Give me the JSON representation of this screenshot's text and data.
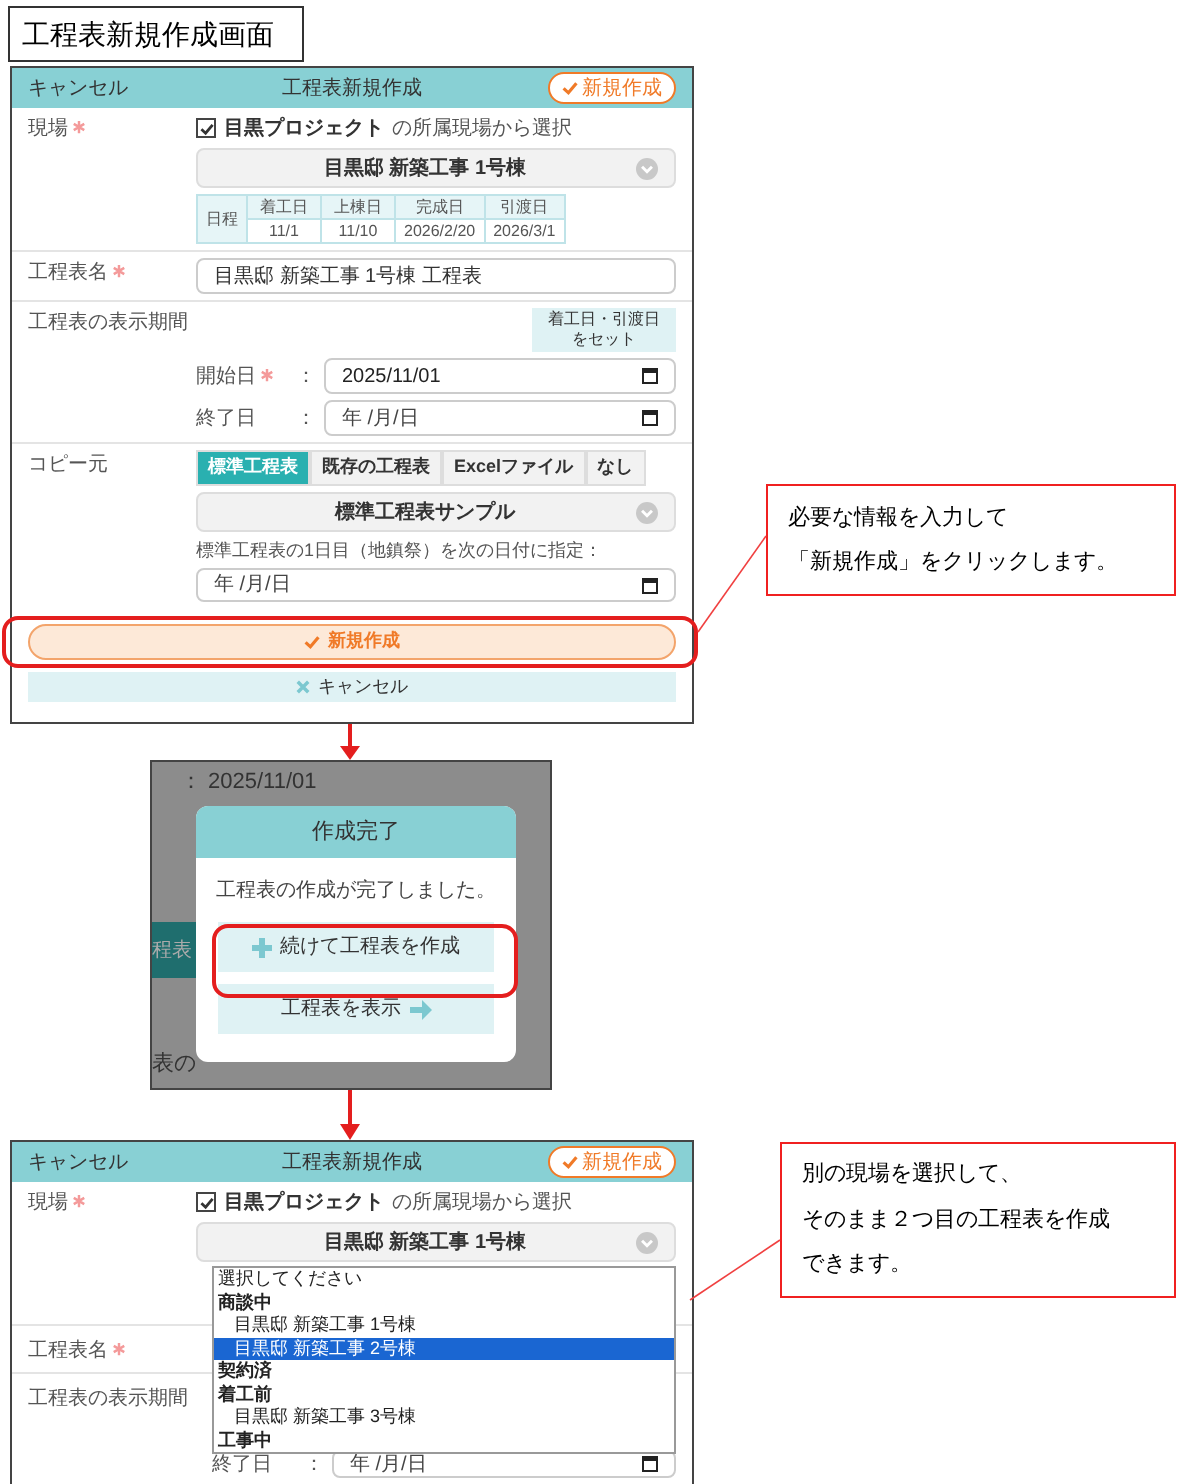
{
  "title": "工程表新規作成画面",
  "form_screen": {
    "header": {
      "cancel": "キャンセル",
      "title": "工程表新規作成",
      "create": "新規作成"
    },
    "site": {
      "label": "現場",
      "required": true,
      "checkbox": {
        "checked": true,
        "project": "目黒プロジェクト",
        "suffix": "の所属現場から選択"
      },
      "select": "目黒邸 新築工事 1号棟",
      "schedule": {
        "row_label": "日程",
        "columns": [
          "着工日",
          "上棟日",
          "完成日",
          "引渡日"
        ],
        "values": [
          "11/1",
          "11/10",
          "2026/2/20",
          "2026/3/1"
        ]
      }
    },
    "name": {
      "label": "工程表名",
      "required": true,
      "value": "目黒邸 新築工事 1号棟 工程表"
    },
    "period": {
      "label": "工程表の表示期間",
      "set_button": [
        "着工日・引渡日",
        "をセット"
      ],
      "fields": [
        {
          "label": "開始日",
          "required": true,
          "separator": "：",
          "value": "2025/11/01"
        },
        {
          "label": "終了日",
          "required": false,
          "separator": "：",
          "placeholder": "年 /月/日"
        }
      ]
    },
    "copy": {
      "label": "コピー元",
      "options": [
        {
          "label": "標準工程表",
          "selected": true
        },
        {
          "label": "既存の工程表",
          "selected": false
        },
        {
          "label": "Excelファイル",
          "selected": false
        },
        {
          "label": "なし",
          "selected": false
        }
      ],
      "select": "標準工程表サンプル",
      "note": "標準工程表の1日目（地鎮祭）を次の日付に指定：",
      "date_placeholder": "年 /月/日"
    },
    "create_button": "新規作成",
    "cancel_button": "キャンセル"
  },
  "callouts": [
    {
      "lines": [
        "必要な情報を入力して",
        "「新規作成」をクリックします。"
      ]
    },
    {
      "lines": [
        "別の現場を選択して、",
        "そのまま２つ目の工程表を作成",
        "できます。"
      ]
    }
  ],
  "dialog_screen": {
    "background": {
      "separator": "：",
      "date": "2025/11/01",
      "tab_fragment": "程表",
      "text_fragment": "表の"
    },
    "dialog": {
      "title": "作成完了",
      "message": "工程表の作成が完了しました。",
      "buttons": [
        {
          "label": "続けて工程表を作成",
          "kind": "add"
        },
        {
          "label": "工程表を表示",
          "kind": "view"
        }
      ]
    }
  },
  "dropdown_screen": {
    "header": {
      "cancel": "キャンセル",
      "title": "工程表新規作成",
      "create": "新規作成"
    },
    "site": {
      "label": "現場",
      "required": true,
      "checkbox": {
        "checked": true,
        "project": "目黒プロジェクト",
        "suffix": "の所属現場から選択"
      },
      "select": "目黒邸 新築工事 1号棟"
    },
    "options": [
      {
        "label": "選択してください",
        "kind": "prompt",
        "selected": false
      },
      {
        "label": "商談中",
        "kind": "group",
        "selected": false
      },
      {
        "label": "目黒邸 新築工事 1号棟",
        "kind": "option",
        "selected": false
      },
      {
        "label": "目黒邸 新築工事 2号棟",
        "kind": "option",
        "selected": true
      },
      {
        "label": "契約済",
        "kind": "group",
        "selected": false
      },
      {
        "label": "着工前",
        "kind": "group",
        "selected": false
      },
      {
        "label": "目黒邸 新築工事 3号棟",
        "kind": "option",
        "selected": false
      },
      {
        "label": "工事中",
        "kind": "group",
        "selected": false
      }
    ],
    "name_label": {
      "label": "工程表名",
      "required": true
    },
    "period_label": "工程表の表示期間",
    "end_field": {
      "label": "終了日",
      "separator": "：",
      "placeholder": "年 /月/日"
    }
  }
}
